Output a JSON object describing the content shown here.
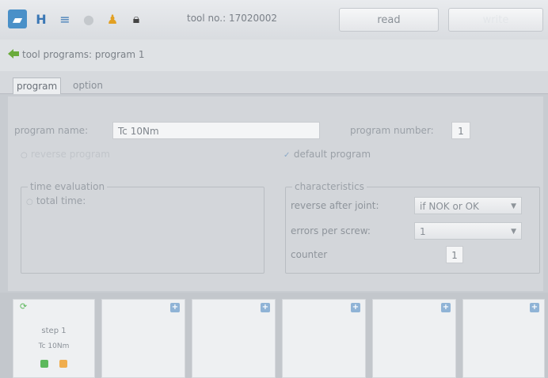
{
  "toolbar": {
    "icons": [
      "folder-icon",
      "save-icon",
      "list-icon",
      "disabled-icon",
      "user-icon",
      "lock-icon"
    ],
    "tool_no_label": "tool no.: 17020002",
    "read_label": "read",
    "write_label": "write"
  },
  "breadcrumb": {
    "text": "tool programs: program 1"
  },
  "tabs": [
    {
      "label": "program",
      "active": true
    },
    {
      "label": "option",
      "active": false
    }
  ],
  "form": {
    "program_name_label": "program name:",
    "program_name_value": "Tc 10Nm",
    "program_number_label": "program number:",
    "program_number_value": "1",
    "reverse_program_label": "reverse program",
    "default_program_label": "default program"
  },
  "time_evaluation": {
    "title": "time evaluation",
    "total_time_label": "total time:"
  },
  "characteristics": {
    "title": "characteristics",
    "reverse_after_joint_label": "reverse after joint:",
    "reverse_after_joint_value": "if NOK or OK",
    "errors_per_screw_label": "errors per screw:",
    "errors_per_screw_value": "1",
    "counter_label": "counter",
    "counter_value": "1"
  },
  "steps": {
    "active_step": {
      "title": "step 1",
      "subtitle": "Tc 10Nm"
    },
    "empty_slots": 5,
    "colors": {
      "plus": "#8fb3d6",
      "ok": "#5cb85c",
      "warn": "#f0ad4e"
    }
  }
}
